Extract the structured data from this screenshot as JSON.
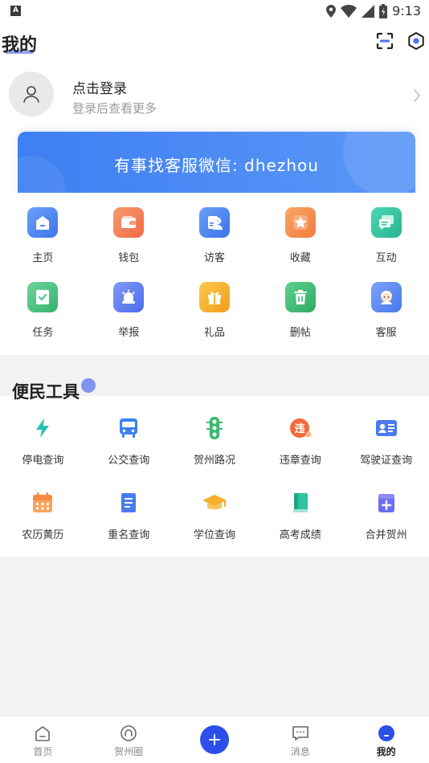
{
  "status_bar": {
    "time": "9:13",
    "icons": [
      "a-icon",
      "location-icon",
      "wifi-icon",
      "signal-icon",
      "battery-icon"
    ]
  },
  "header": {
    "title": "我的",
    "icons": [
      "scan-icon",
      "settings-icon"
    ]
  },
  "profile": {
    "title": "点击登录",
    "subtitle": "登录后查看更多"
  },
  "banner": {
    "text": "有事找客服微信: dhezhou"
  },
  "features": [
    {
      "label": "主页",
      "icon": "home-icon",
      "color": "#4a82f0"
    },
    {
      "label": "钱包",
      "icon": "wallet-icon",
      "color": "#f27a52"
    },
    {
      "label": "访客",
      "icon": "visitor-icon",
      "color": "#3c7cf0"
    },
    {
      "label": "收藏",
      "icon": "star-icon",
      "color": "#f28a45"
    },
    {
      "label": "互动",
      "icon": "chat-icon",
      "color": "#2fc29f"
    },
    {
      "label": "任务",
      "icon": "task-icon",
      "color": "#45c17f"
    },
    {
      "label": "举报",
      "icon": "report-icon",
      "color": "#5a7cf0"
    },
    {
      "label": "礼品",
      "icon": "gift-icon",
      "color": "#f5b02c"
    },
    {
      "label": "删帖",
      "icon": "trash-icon",
      "color": "#3fbf74"
    },
    {
      "label": "客服",
      "icon": "service-icon",
      "color": "#5a86f0"
    }
  ],
  "tools": {
    "title": "便民工具",
    "items": [
      {
        "label": "停电查询",
        "icon": "lightning-icon",
        "color": "#2bc0b0"
      },
      {
        "label": "公交查询",
        "icon": "bus-icon",
        "color": "#3b82f0"
      },
      {
        "label": "贺州路况",
        "icon": "traffic-light-icon",
        "color": "#3cb86e"
      },
      {
        "label": "违章查询",
        "icon": "violation-icon",
        "color": "#f26a3a",
        "glyph": "违"
      },
      {
        "label": "驾驶证查询",
        "icon": "license-icon",
        "color": "#4a7af0"
      },
      {
        "label": "农历黄历",
        "icon": "calendar-icon",
        "color": "#f28a45"
      },
      {
        "label": "重名查询",
        "icon": "document-icon",
        "color": "#4a7af0"
      },
      {
        "label": "学位查询",
        "icon": "graduation-cap-icon",
        "color": "#f5b02c"
      },
      {
        "label": "高考成绩",
        "icon": "book-icon",
        "color": "#2fc29f"
      },
      {
        "label": "合并贺州",
        "icon": "merge-icon",
        "color": "#6b6ef0"
      }
    ]
  },
  "tabbar": [
    {
      "label": "首页",
      "icon": "home-tab-icon",
      "active": false
    },
    {
      "label": "贺州圈",
      "icon": "circle-tab-icon",
      "active": false
    },
    {
      "label": "",
      "icon": "plus-icon",
      "active": false
    },
    {
      "label": "消息",
      "icon": "message-tab-icon",
      "active": false
    },
    {
      "label": "我的",
      "icon": "me-tab-icon",
      "active": true
    }
  ]
}
